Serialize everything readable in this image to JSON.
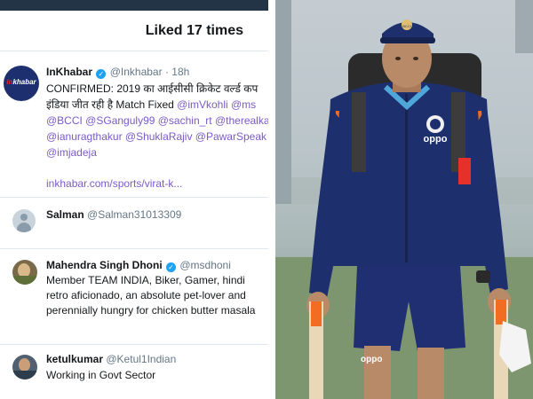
{
  "header": {
    "title": "Liked 17 times"
  },
  "tweet": {
    "name": "InKhabar",
    "handle": "@Inkhabar",
    "time": "· 18h",
    "lines": [
      "CONFIRMED: 2019 का आईसीसी क्रिकेट वर्ल्ड कप",
      "इंडिया जीत रही है Match Fixed @imVkohli @ms",
      "@BCCI @SGanguly99 @sachin_rt @therealka",
      "@ianuragthakur @ShuklaRajiv @PawarSpeak",
      "@imjadeja"
    ],
    "link": "inkhabar.com/sports/virat-k..."
  },
  "users": [
    {
      "name": "Salman",
      "handle": "@Salman31013309",
      "bio": ""
    },
    {
      "name": "Mahendra Singh Dhoni",
      "handle": "@msdhoni",
      "bio": "Member TEAM INDIA, Biker, Gamer, hindi retro aficionado, an absolute pet-lover and perennially hungry for chicken butter masala"
    },
    {
      "name": "ketulkumar",
      "handle": "@Ketul1Indian",
      "bio": "Working in Govt Sector"
    }
  ],
  "photo": {
    "cap_badge": "BCCI",
    "shirt_logo": "oppo",
    "shorts_logo": "oppo"
  },
  "icons": {
    "verified": "verified-badge-icon"
  },
  "colors": {
    "link": "#7b5ac6",
    "verified": "#1da1f2",
    "jersey": "#1e2f6e"
  }
}
